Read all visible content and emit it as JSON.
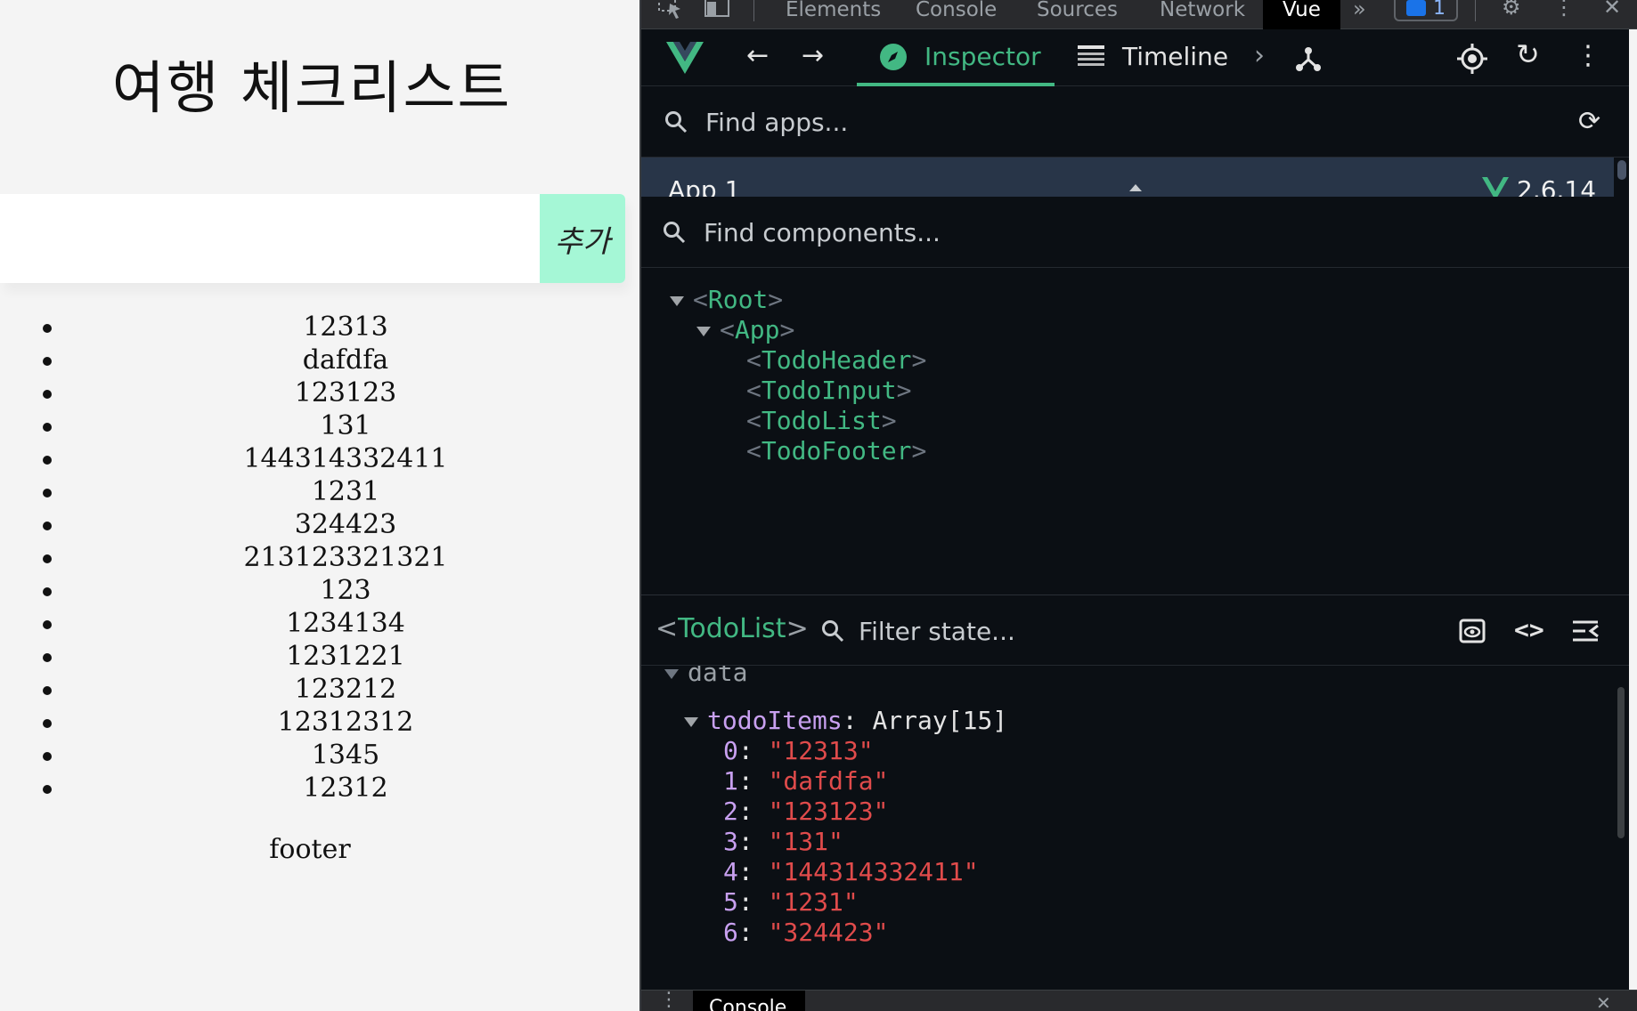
{
  "page": {
    "title": "여행 체크리스트",
    "input_placeholder": "",
    "add_button": "추가",
    "todos": [
      "12313",
      "dafdfa",
      "123123",
      "131",
      "144314332411",
      "1231",
      "324423",
      "213123321321",
      "123",
      "1234134",
      "1231221",
      "123212",
      "12312312",
      "1345",
      "12312"
    ],
    "footer": "footer"
  },
  "devtools": {
    "tabs": [
      "Elements",
      "Console",
      "Sources",
      "Network",
      "Vue"
    ],
    "active_tab": "Vue",
    "message_count": "1",
    "vue": {
      "tabs": {
        "inspector": "Inspector",
        "timeline": "Timeline"
      },
      "find_apps_placeholder": "Find apps...",
      "app": {
        "name": "App 1",
        "version": "2.6.14"
      },
      "find_components_placeholder": "Find components...",
      "tree": {
        "root": "Root",
        "app": "App",
        "children": [
          "TodoHeader",
          "TodoInput",
          "TodoList",
          "TodoFooter"
        ]
      },
      "selected_component": "TodoList",
      "filter_state_placeholder": "Filter state...",
      "state": {
        "section": "data",
        "key": "todoItems",
        "type": "Array[15]",
        "items": [
          {
            "index": "0",
            "value": "\"12313\""
          },
          {
            "index": "1",
            "value": "\"dafdfa\""
          },
          {
            "index": "2",
            "value": "\"123123\""
          },
          {
            "index": "3",
            "value": "\"131\""
          },
          {
            "index": "4",
            "value": "\"144314332411\""
          },
          {
            "index": "5",
            "value": "\"1231\""
          },
          {
            "index": "6",
            "value": "\"324423\""
          }
        ]
      }
    },
    "drawer_tab": "Console"
  },
  "colors": {
    "vue_green": "#42b883",
    "add_button_bg": "#a5f7d6",
    "state_string": "#e04b4b",
    "state_key": "#c8a0f0"
  }
}
